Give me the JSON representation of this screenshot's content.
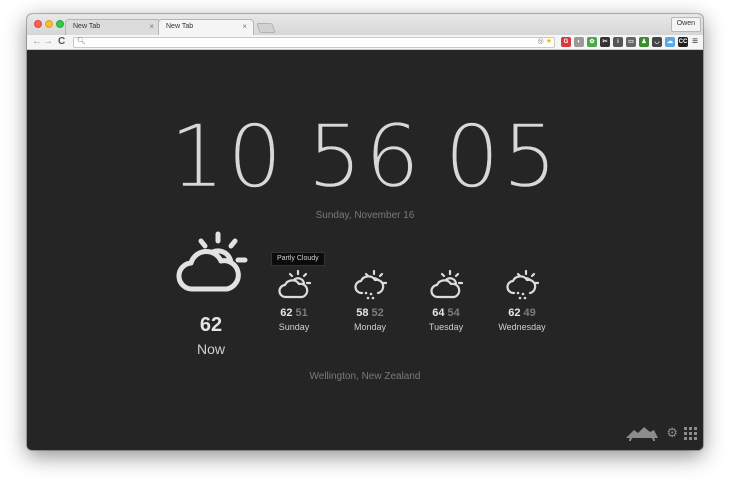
{
  "browser": {
    "tabs": [
      {
        "title": "New Tab",
        "close": "×"
      },
      {
        "title": "New Tab",
        "close": "×"
      }
    ],
    "user": "Owen",
    "icons": [
      "back-arrow-icon",
      "forward-arrow-icon",
      "reload-icon",
      "search-icon",
      "location-icon",
      "star-icon",
      "menu-icon"
    ],
    "extensions": [
      {
        "name": "grammarly-icon",
        "label": "G",
        "color": "#d6393e"
      },
      {
        "name": "extension-gray-icon",
        "label": "◐",
        "color": "#9a9a9a"
      },
      {
        "name": "evernote-icon",
        "label": "✿",
        "color": "#4aa84c"
      },
      {
        "name": "scissors-icon",
        "label": "✂",
        "color": "#333333"
      },
      {
        "name": "info-icon",
        "label": "i",
        "color": "#555555"
      },
      {
        "name": "chat-icon",
        "label": "▭",
        "color": "#666666"
      },
      {
        "name": "person-icon",
        "label": "♟",
        "color": "#3b8a2f"
      },
      {
        "name": "pocket-icon",
        "label": "◡",
        "color": "#444444"
      },
      {
        "name": "cloud-icon",
        "label": "☁",
        "color": "#5aa9e6"
      },
      {
        "name": "cc-icon",
        "label": "CC",
        "color": "#222222"
      }
    ]
  },
  "clock": {
    "hours": "10",
    "minutes": "56",
    "seconds": "05",
    "date": "Sunday, November 16"
  },
  "weather": {
    "now": {
      "temp": "62",
      "label": "Now",
      "icon": "partly-cloudy-icon"
    },
    "tooltip": "Partly Cloudy",
    "forecast": [
      {
        "high": "62",
        "low": "51",
        "day": "Sunday",
        "icon": "partly-cloudy-icon"
      },
      {
        "high": "58",
        "low": "52",
        "day": "Monday",
        "icon": "rain-icon"
      },
      {
        "high": "64",
        "low": "54",
        "day": "Tuesday",
        "icon": "partly-cloudy-icon"
      },
      {
        "high": "62",
        "low": "49",
        "day": "Wednesday",
        "icon": "rain-icon"
      }
    ],
    "location": "Wellington, New Zealand"
  },
  "colors": {
    "background": "#252525",
    "clock_text": "#d8d8d8",
    "muted_text": "#7a7a7a"
  }
}
